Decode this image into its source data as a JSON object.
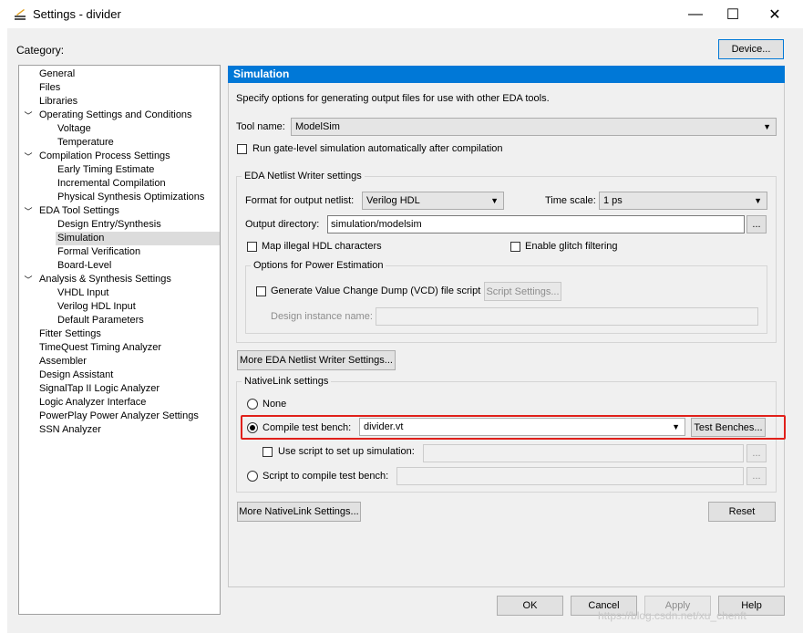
{
  "window": {
    "title": "Settings - divider",
    "minimize": "—",
    "maximize": "☐",
    "close": "✕"
  },
  "category_label": "Category:",
  "device_button": "Device...",
  "tree": [
    {
      "label": "General",
      "level": 0,
      "expander": ""
    },
    {
      "label": "Files",
      "level": 0,
      "expander": ""
    },
    {
      "label": "Libraries",
      "level": 0,
      "expander": ""
    },
    {
      "label": "Operating Settings and Conditions",
      "level": 0,
      "expander": "﹀"
    },
    {
      "label": "Voltage",
      "level": 1,
      "expander": ""
    },
    {
      "label": "Temperature",
      "level": 1,
      "expander": ""
    },
    {
      "label": "Compilation Process Settings",
      "level": 0,
      "expander": "﹀"
    },
    {
      "label": "Early Timing Estimate",
      "level": 1,
      "expander": ""
    },
    {
      "label": "Incremental Compilation",
      "level": 1,
      "expander": ""
    },
    {
      "label": "Physical Synthesis Optimizations",
      "level": 1,
      "expander": ""
    },
    {
      "label": "EDA Tool Settings",
      "level": 0,
      "expander": "﹀"
    },
    {
      "label": "Design Entry/Synthesis",
      "level": 1,
      "expander": ""
    },
    {
      "label": "Simulation",
      "level": 1,
      "expander": "",
      "selected": true
    },
    {
      "label": "Formal Verification",
      "level": 1,
      "expander": ""
    },
    {
      "label": "Board-Level",
      "level": 1,
      "expander": ""
    },
    {
      "label": "Analysis & Synthesis Settings",
      "level": 0,
      "expander": "﹀"
    },
    {
      "label": "VHDL Input",
      "level": 1,
      "expander": ""
    },
    {
      "label": "Verilog HDL Input",
      "level": 1,
      "expander": ""
    },
    {
      "label": "Default Parameters",
      "level": 1,
      "expander": ""
    },
    {
      "label": "Fitter Settings",
      "level": 0,
      "expander": ""
    },
    {
      "label": "TimeQuest Timing Analyzer",
      "level": 0,
      "expander": ""
    },
    {
      "label": "Assembler",
      "level": 0,
      "expander": ""
    },
    {
      "label": "Design Assistant",
      "level": 0,
      "expander": ""
    },
    {
      "label": "SignalTap II Logic Analyzer",
      "level": 0,
      "expander": ""
    },
    {
      "label": "Logic Analyzer Interface",
      "level": 0,
      "expander": ""
    },
    {
      "label": "PowerPlay Power Analyzer Settings",
      "level": 0,
      "expander": ""
    },
    {
      "label": "SSN Analyzer",
      "level": 0,
      "expander": ""
    }
  ],
  "sim": {
    "header": "Simulation",
    "description": "Specify options for generating output files for use with other EDA tools.",
    "tool_name_label": "Tool name:",
    "tool_name_value": "ModelSim",
    "gate_level_label": "Run gate-level simulation automatically after compilation",
    "eda_group": "EDA Netlist Writer settings",
    "format_label": "Format for output netlist:",
    "format_value": "Verilog HDL",
    "timescale_label": "Time scale:",
    "timescale_value": "1 ps",
    "outdir_label": "Output directory:",
    "outdir_value": "simulation/modelsim",
    "browse": "...",
    "map_illegal": "Map illegal HDL characters",
    "glitch": "Enable glitch filtering",
    "power_group": "Options for Power Estimation",
    "vcd_label": "Generate Value Change Dump (VCD) file script",
    "script_settings": "Script Settings...",
    "instance_label": "Design instance name:",
    "more_eda": "More EDA Netlist Writer Settings...",
    "nativelink_group": "NativeLink settings",
    "none_label": "None",
    "compile_tb_label": "Compile test bench:",
    "compile_tb_value": "divider.vt",
    "test_benches": "Test Benches...",
    "use_script_label": "Use script to set up simulation:",
    "script_compile_label": "Script to compile test bench:",
    "more_nativelink": "More NativeLink Settings...",
    "reset": "Reset"
  },
  "footer": {
    "ok": "OK",
    "cancel": "Cancel",
    "apply": "Apply",
    "help": "Help"
  },
  "watermark": "https://blog.csdn.net/xu_chenft"
}
